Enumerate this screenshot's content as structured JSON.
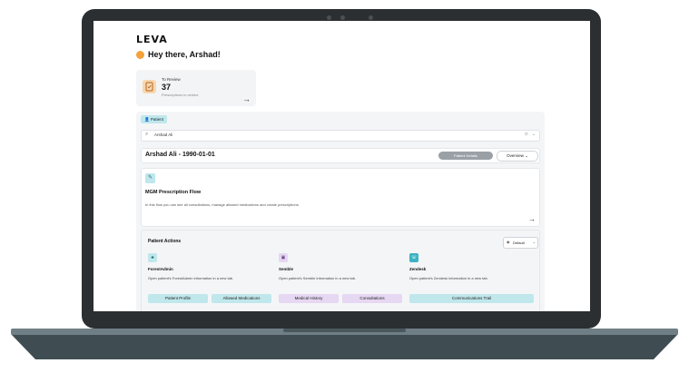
{
  "app": {
    "logo": "LEVA"
  },
  "greeting": "Hey there, Arshad!",
  "review": {
    "title": "To Review",
    "count": "37",
    "subtitle": "Prescriptions to review"
  },
  "patient_badge": "Patient",
  "search": {
    "value": "Arshad Ali"
  },
  "patient": {
    "name": "Arshad Ali - 1990-01-01",
    "details_button": "Patient Details",
    "overview_button": "Overview"
  },
  "flow": {
    "title": "MGM Prescription Flow",
    "description": "In this flow you can see all consultations, manage allowed medications and create prescriptions."
  },
  "actions": {
    "title": "Patient Actions",
    "default_button": "Default",
    "items": [
      {
        "name": "ForestAdmin",
        "description": "Open patient's ForestAdmin information in a new tab."
      },
      {
        "name": "Semble",
        "description": "Open patient's Semble information in a new tab."
      },
      {
        "name": "Zendesk",
        "description": "Open patient's Zendesk information in a new tab."
      }
    ],
    "tiles": [
      "Patient Profile",
      "Allowed Medications",
      "Medical History",
      "Consultations",
      "Communications Trail"
    ]
  },
  "colors": {
    "accent": "#bfe7ec",
    "tile_cyan": "#bfe7ec",
    "tile_purple": "#e6d7f3",
    "greeting_dot": "#f4a23a"
  }
}
